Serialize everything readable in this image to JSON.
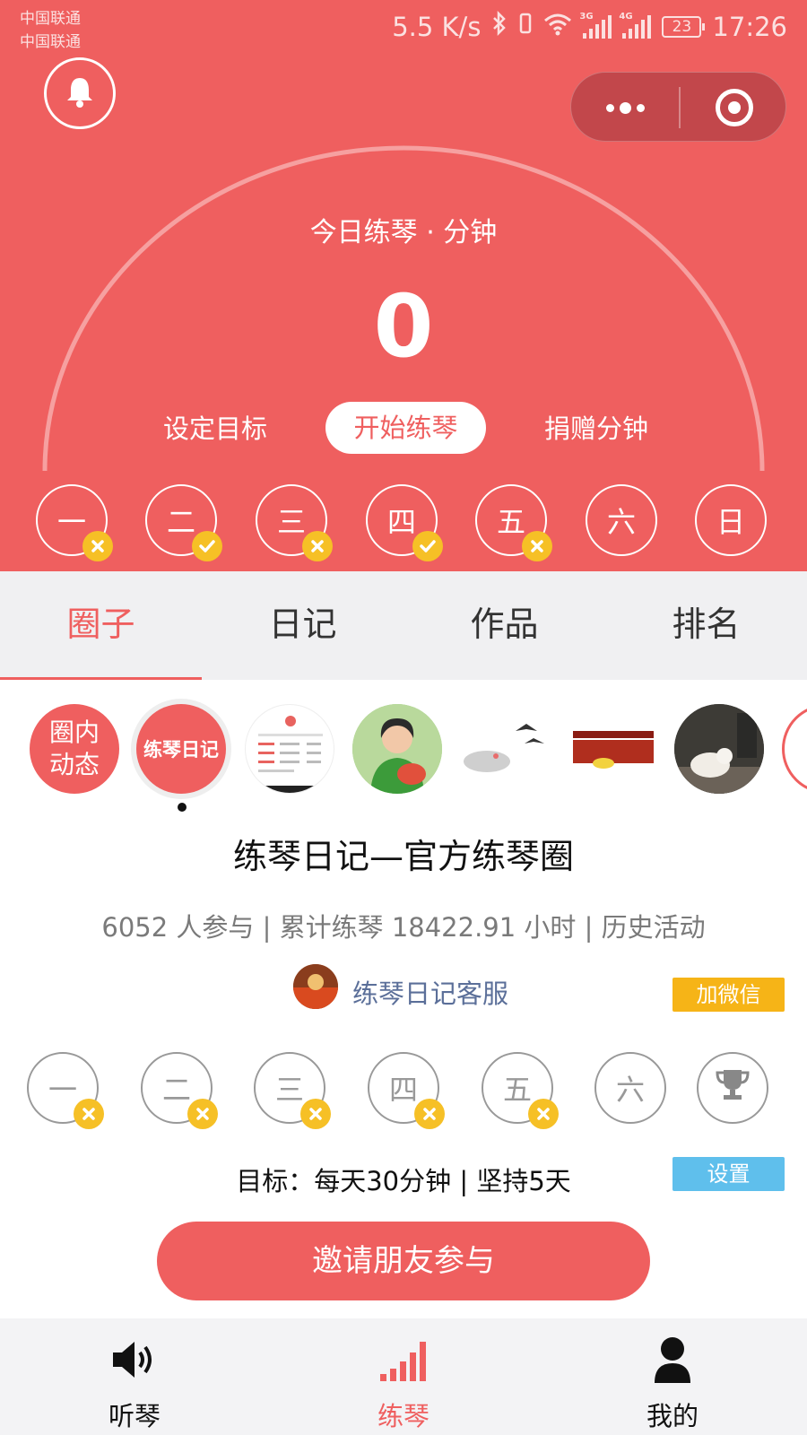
{
  "status_bar": {
    "carrier_1": "中国联通",
    "carrier_2": "中国联通",
    "net_speed": "5.5 K/s",
    "signal_1_tag": "3G",
    "signal_2_tag": "4G",
    "battery": "23",
    "time": "17:26"
  },
  "header": {
    "icons": {
      "bell": "bell-icon",
      "more": "more-dots-icon",
      "close": "target-close-icon"
    },
    "today_label": "今日练琴 · 分钟",
    "today_minutes": "0",
    "set_goal": "设定目标",
    "start_practice": "开始练琴",
    "donate_minutes": "捐赠分钟",
    "week_days": [
      {
        "label": "一",
        "status": "missed"
      },
      {
        "label": "二",
        "status": "done"
      },
      {
        "label": "三",
        "status": "missed"
      },
      {
        "label": "四",
        "status": "done"
      },
      {
        "label": "五",
        "status": "missed"
      },
      {
        "label": "六",
        "status": "none"
      },
      {
        "label": "日",
        "status": "none"
      }
    ]
  },
  "tabs": [
    {
      "label": "圈子",
      "active": true
    },
    {
      "label": "日记",
      "active": false
    },
    {
      "label": "作品",
      "active": false
    },
    {
      "label": "排名",
      "active": false
    }
  ],
  "circles": {
    "feed_line_1": "圈内",
    "feed_line_2": "动态",
    "diary": "练琴日记"
  },
  "circle_info": {
    "title": "练琴日记—官方练琴圈",
    "stats": "6052 人参与 | 累计练琴 18422.91 小时 | 历史活动",
    "service_name": "练琴日记客服",
    "add_wechat": "加微信",
    "goal_days": [
      {
        "label": "一",
        "status": "missed"
      },
      {
        "label": "二",
        "status": "missed"
      },
      {
        "label": "三",
        "status": "missed"
      },
      {
        "label": "四",
        "status": "missed"
      },
      {
        "label": "五",
        "status": "missed"
      },
      {
        "label": "六",
        "status": "none"
      }
    ],
    "trophy_icon": "trophy-icon",
    "goal_text": "目标：每天30分钟 | 坚持5天",
    "settings": "设置",
    "invite": "邀请朋友参与"
  },
  "bottom_nav": [
    {
      "label": "听琴",
      "icon": "speaker-icon",
      "active": false
    },
    {
      "label": "练琴",
      "icon": "signal-bars-icon",
      "active": true
    },
    {
      "label": "我的",
      "icon": "user-icon",
      "active": false
    }
  ],
  "colors": {
    "brand_red": "#ef5f5f",
    "badge_yellow": "#f6c026",
    "wechat_orange": "#f6b417",
    "settings_blue": "#5fbfec",
    "link_blue": "#5b6f99"
  }
}
